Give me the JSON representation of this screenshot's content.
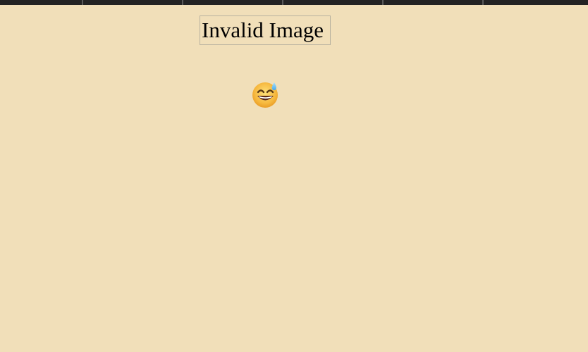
{
  "header": {
    "segments": [
      {
        "name": "segment-1"
      },
      {
        "name": "segment-2"
      },
      {
        "name": "segment-3"
      },
      {
        "name": "segment-4"
      },
      {
        "name": "segment-5"
      },
      {
        "name": "segment-6"
      }
    ]
  },
  "main": {
    "image_placeholder_text": "Invalid Image",
    "emoji_icon": "grinning-face-with-sweat"
  },
  "colors": {
    "page_background": "#f1dfb9",
    "top_strip": "#232323",
    "placeholder_border": "#b8b29f"
  }
}
